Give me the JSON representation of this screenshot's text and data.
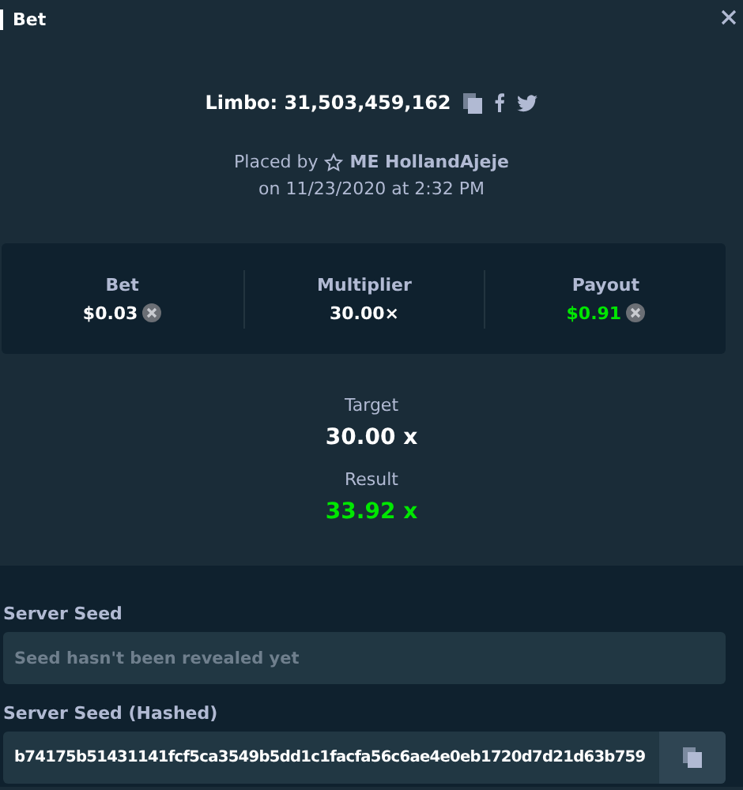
{
  "title": "Bet",
  "game": "Limbo: 31,503,459,162",
  "placed_by": "Placed by",
  "user": "ME HollandAjeje",
  "date": "on 11/23/2020 at 2:32 PM",
  "stats": [
    {
      "label": "Bet",
      "value": "$0.03",
      "kind": "amount",
      "color": "#ffffff"
    },
    {
      "label": "Multiplier",
      "value": "30.00×",
      "kind": "multiplier",
      "color": "#ffffff"
    },
    {
      "label": "Payout",
      "value": "$0.91",
      "kind": "amount",
      "color": "#00e701"
    }
  ],
  "outcomes": [
    {
      "label": "Target",
      "value": "30.00 x",
      "color": "#ffffff"
    },
    {
      "label": "Result",
      "value": "33.92 x",
      "color": "#00e701"
    }
  ],
  "seeds": [
    {
      "label": "Server Seed",
      "placeholder": "Seed hasn't been revealed yet",
      "copyable": false
    },
    {
      "label": "Server Seed (Hashed)",
      "value": "b74175b51431141fcf5ca3549b5dd1c1facfa56c6ae4e0eb1720d7d21d63b759",
      "copyable": true
    }
  ]
}
